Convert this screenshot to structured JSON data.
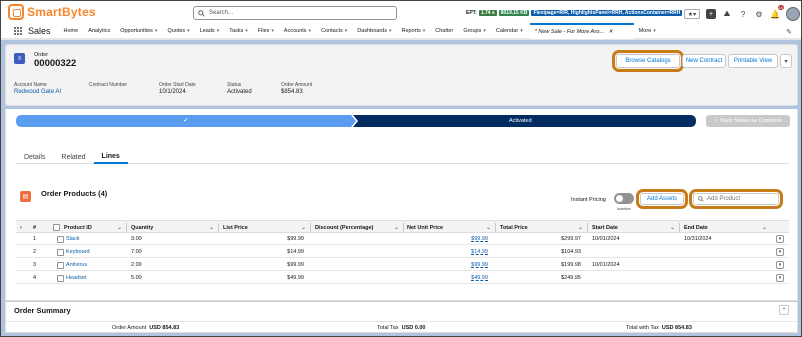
{
  "header": {
    "brand": "SmartBytes",
    "search_placeholder": "Search...",
    "ept_label": "EPT:",
    "ept_time": "1.74 s",
    "ept_size": "8019.15 KB",
    "ept_flags": "Flexipage=R/R, HighlightsPanel=RRH, ActionsContainer=RRH",
    "notification_count": "14"
  },
  "nav": {
    "app_name": "Sales",
    "items": [
      "Home",
      "Analytics",
      "Opportunities",
      "Quotes",
      "Leads",
      "Tasks",
      "Files",
      "Accounts",
      "Contacts",
      "Dashboards",
      "Reports",
      "Chatter",
      "Groups",
      "Calendar"
    ],
    "dropdown_items": [
      false,
      false,
      true,
      true,
      true,
      true,
      true,
      true,
      true,
      true,
      true,
      false,
      true,
      true
    ],
    "active_tab": "* New Sale - For More Ass...",
    "more": "More"
  },
  "record": {
    "type": "Order",
    "number": "00000322",
    "buttons": {
      "browse": "Browse Catalogs",
      "new_contract": "New Contract",
      "printable": "Printable View"
    },
    "fields": [
      {
        "label": "Account Name",
        "value": "Redwood Gate AI"
      },
      {
        "label": "Contract Number",
        "value": ""
      },
      {
        "label": "Order Start Date",
        "value": "10/1/2024"
      },
      {
        "label": "Status",
        "value": "Activated"
      },
      {
        "label": "Order Amount",
        "value": "$854.83"
      }
    ]
  },
  "path": {
    "current_stage": "Activated",
    "mark_button": "Mark Status as Complete"
  },
  "tabs": [
    "Details",
    "Related",
    "Lines"
  ],
  "active_tab_index": 2,
  "order_products": {
    "title": "Order Products (4)",
    "instant_pricing": "Instant Pricing",
    "toggle_state": "Inactive",
    "add_assets": "Add Assets",
    "add_product_placeholder": "Add Product",
    "columns": [
      "#",
      "Product ID",
      "Quantity",
      "List Price",
      "Discount (Percentage)",
      "Net Unit Price",
      "Total Price",
      "Start Date",
      "End Date"
    ],
    "rows": [
      {
        "n": "1",
        "product": "Slack",
        "qty": "3.00",
        "list": "$99.99",
        "discount": "",
        "net": "$99.99",
        "total": "$299.97",
        "start": "10/01/2024",
        "end": "10/31/2024"
      },
      {
        "n": "2",
        "product": "Keyboard",
        "qty": "7.00",
        "list": "$14.99",
        "discount": "",
        "net": "$14.99",
        "total": "$104.93",
        "start": "",
        "end": ""
      },
      {
        "n": "3",
        "product": "Antivirus",
        "qty": "2.00",
        "list": "$99.99",
        "discount": "",
        "net": "$99.99",
        "total": "$199.98",
        "start": "10/01/2024",
        "end": ""
      },
      {
        "n": "4",
        "product": "Headset",
        "qty": "5.00",
        "list": "$49.99",
        "discount": "",
        "net": "$49.99",
        "total": "$249.95",
        "start": "",
        "end": ""
      }
    ]
  },
  "summary": {
    "title": "Order Summary",
    "order_amount_label": "Order Amount",
    "order_amount_value": "USD 854.83",
    "total_tax_label": "Total Tax",
    "total_tax_value": "USD 0.00",
    "total_with_tax_label": "Total with Tax",
    "total_with_tax_value": "USD 854.83"
  },
  "colors": {
    "accent": "#0176d3",
    "highlight": "#c97b17",
    "path_done": "#5a9cf0",
    "path_current": "#032d60",
    "brand": "#f5862e"
  }
}
